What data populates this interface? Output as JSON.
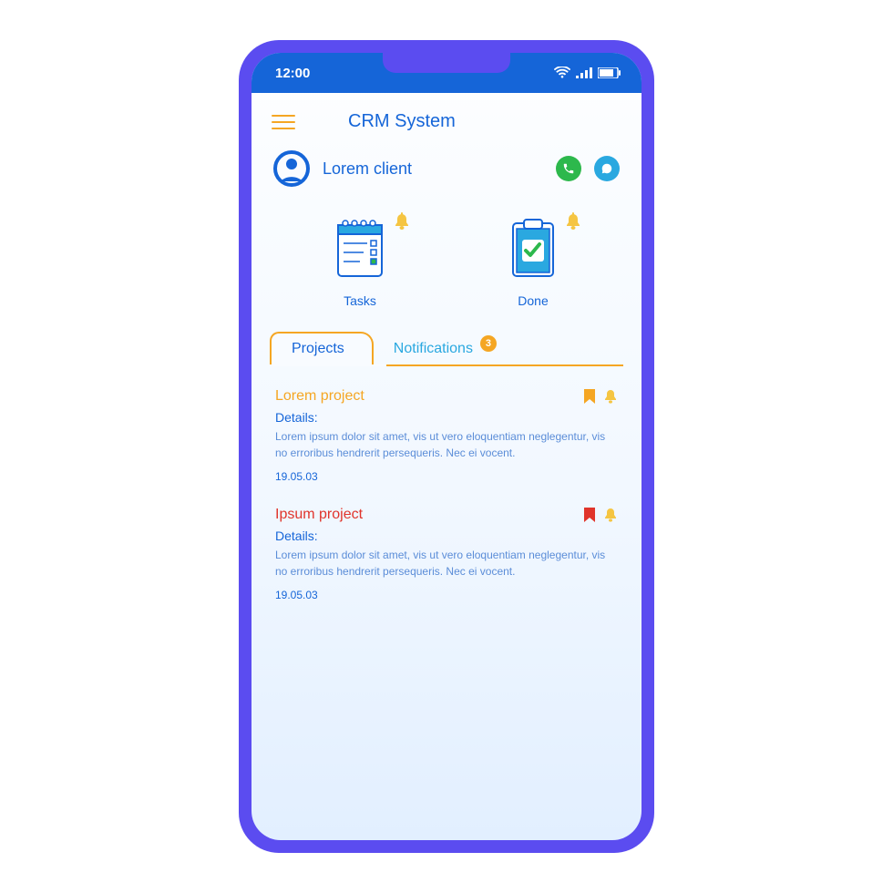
{
  "status": {
    "time": "12:00"
  },
  "header": {
    "title": "CRM System"
  },
  "client": {
    "name": "Lorem client"
  },
  "cards": {
    "tasks": "Tasks",
    "done": "Done"
  },
  "tabs": {
    "projects": "Projects",
    "notifications": "Notifications",
    "notification_count": "3"
  },
  "projects": [
    {
      "title": "Lorem project",
      "color": "orange",
      "details_label": "Details:",
      "body": "Lorem ipsum dolor sit amet, vis ut vero eloquentiam neglegentur, vis no erroribus hendrerit persequeris. Nec ei vocent.",
      "date": "19.05.03",
      "bookmark_color": "#f5a623"
    },
    {
      "title": "Ipsum project",
      "color": "red",
      "details_label": "Details:",
      "body": "Lorem ipsum dolor sit amet, vis ut vero eloquentiam neglegentur, vis no erroribus hendrerit persequeris. Nec ei vocent.",
      "date": "19.05.03",
      "bookmark_color": "#e0342b"
    }
  ],
  "colors": {
    "primary_blue": "#1565d8",
    "accent_orange": "#f5a623",
    "light_blue": "#2aa8e0",
    "frame_purple": "#5b4cf0",
    "green": "#2db84c",
    "red": "#e0342b"
  }
}
